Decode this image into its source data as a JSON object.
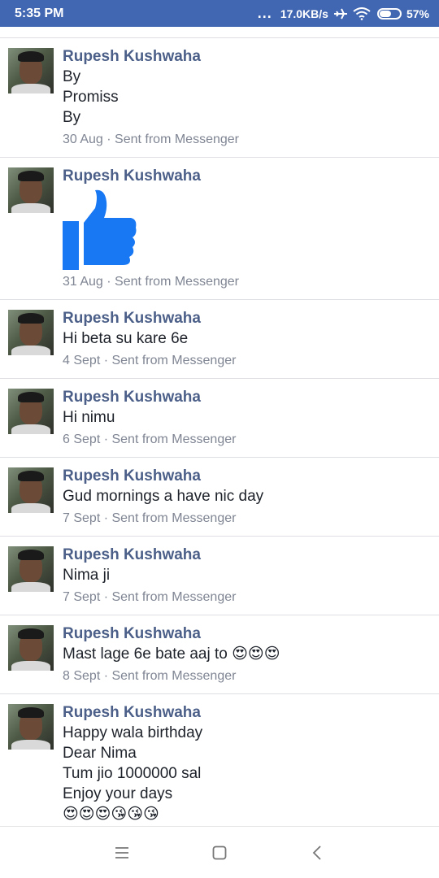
{
  "status_bar": {
    "time": "5:35 PM",
    "dots": "...",
    "speed": "17.0KB/s",
    "battery": "57%"
  },
  "messages": [
    {
      "name": "Rupesh Kushwaha",
      "lines": [
        "By",
        "Promiss",
        "By"
      ],
      "date": "30 Aug",
      "source": "Sent from Messenger"
    },
    {
      "name": "Rupesh Kushwaha",
      "lines": [],
      "sticker": "thumbs-up",
      "date": "31 Aug",
      "source": "Sent from Messenger"
    },
    {
      "name": "Rupesh Kushwaha",
      "lines": [
        "Hi beta su kare 6e"
      ],
      "date": "4 Sept",
      "source": "Sent from Messenger"
    },
    {
      "name": "Rupesh Kushwaha",
      "lines": [
        "Hi nimu"
      ],
      "date": "6 Sept",
      "source": "Sent from Messenger"
    },
    {
      "name": "Rupesh Kushwaha",
      "lines": [
        "Gud mornings a have nic day"
      ],
      "date": "7 Sept",
      "source": "Sent from Messenger"
    },
    {
      "name": "Rupesh Kushwaha",
      "lines": [
        "Nima ji"
      ],
      "date": "7 Sept",
      "source": "Sent from Messenger"
    },
    {
      "name": "Rupesh Kushwaha",
      "lines": [
        "Mast lage 6e bate aaj to 😍😍😍"
      ],
      "date": "8 Sept",
      "source": "Sent from Messenger"
    },
    {
      "name": "Rupesh Kushwaha",
      "lines": [
        "Happy wala birthday",
        "Dear Nima",
        "Tum jio 1000000 sal",
        "Enjoy your days",
        "😍😍😍😘😘😘"
      ],
      "date": "",
      "source": ""
    }
  ],
  "separator": " · ",
  "colors": {
    "status_bar": "#4267b2",
    "name": "#4b5f88",
    "thumb": "#1877f2"
  },
  "nav": {
    "icons": [
      "menu-icon",
      "home-icon",
      "back-icon"
    ]
  }
}
